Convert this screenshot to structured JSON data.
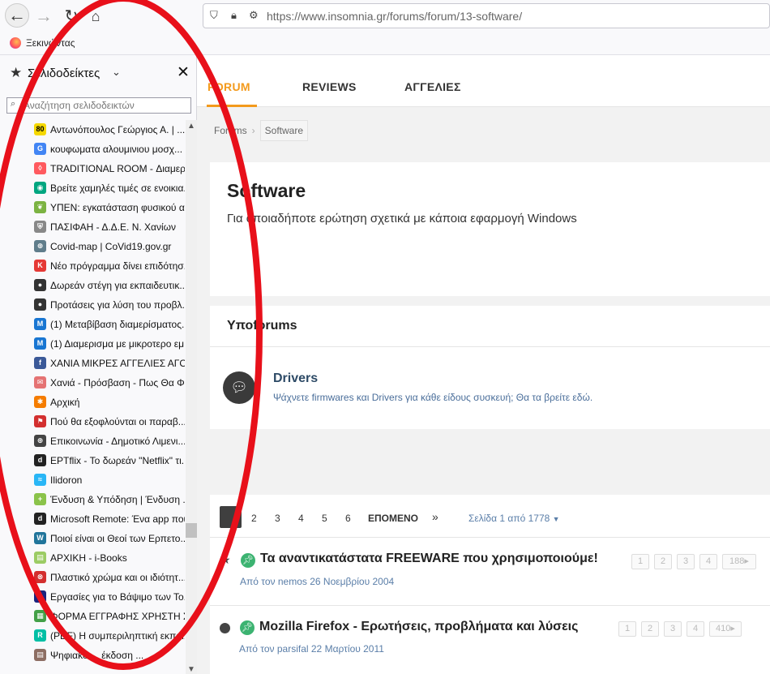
{
  "browser": {
    "url": "https://www.insomnia.gr/forums/forum/13-software/",
    "bookmarks_toolbar_label": "Ξεκινώντας"
  },
  "sidebar": {
    "title": "Σελιδοδείκτες",
    "search_placeholder": "Αναζήτηση σελιδοδεικτών",
    "items": [
      {
        "label": "Αντωνόπουλος Γεώργιος Α. | ...",
        "icon": "80",
        "color": "#f5d800"
      },
      {
        "label": "κουφωματα αλουμινιου μοσχ...",
        "icon": "G",
        "color": "#4285f4"
      },
      {
        "label": "TRADITIONAL ROOM - Διαμερί...",
        "icon": "airbnb",
        "color": "#ff5a5f"
      },
      {
        "label": "Βρείτε χαμηλές τιμές σε ενοικια...",
        "icon": "tripadvisor",
        "color": "#00a680"
      },
      {
        "label": "ΥΠΕΝ: εγκατάσταση φυσικού α...",
        "icon": "leaf",
        "color": "#7cb342"
      },
      {
        "label": "ΠΑΣΙΦΑΗ - Δ.Δ.Ε. Ν. Χανίων",
        "icon": "shield",
        "color": "#888888"
      },
      {
        "label": "Covid-map | CoVid19.gov.gr",
        "icon": "globe",
        "color": "#607d8b"
      },
      {
        "label": "Νέο πρόγραμμα δίνει επιδότησ...",
        "icon": "K",
        "color": "#e53935"
      },
      {
        "label": "Δωρεάν στέγη για εκπαιδευτικ...",
        "icon": "head",
        "color": "#333333"
      },
      {
        "label": "Προτάσεις για λύση του προβλ...",
        "icon": "head",
        "color": "#333333"
      },
      {
        "label": "(1) Μεταβίβαση διαμερίσματος...",
        "icon": "M",
        "color": "#1976d2"
      },
      {
        "label": "(1) Διαμερισμα με μικροτερο εμ...",
        "icon": "M",
        "color": "#1976d2"
      },
      {
        "label": "ΧΑΝΙΑ ΜΙΚΡΕΣ ΑΓΓΕΛΙΕΣ ΑΓΟΡ...",
        "icon": "f",
        "color": "#3b5998"
      },
      {
        "label": "Χανιά - Πρόσβαση - Πως Θα Φ...",
        "icon": "envelope",
        "color": "#e57373"
      },
      {
        "label": "Αρχική",
        "icon": "joomla",
        "color": "#f57c00"
      },
      {
        "label": "Πού θα εξοφλούνται οι παραβ...",
        "icon": "flag",
        "color": "#d32f2f"
      },
      {
        "label": "Επικοινωνία - Δημοτικό Λιμενι...",
        "icon": "globe",
        "color": "#444444"
      },
      {
        "label": "EPTflix - Το δωρεάν \"Netflix\" τι...",
        "icon": "d",
        "color": "#222222"
      },
      {
        "label": "Ilidoron",
        "icon": "wave",
        "color": "#29b6f6"
      },
      {
        "label": "Ένδυση & Υπόδηση | Ένδυση ...",
        "icon": "plus",
        "color": "#8bc34a"
      },
      {
        "label": "Microsoft Remote: Ένα app που...",
        "icon": "d",
        "color": "#222222"
      },
      {
        "label": "Ποιοί είναι οι Θεοί των Ερπετο...",
        "icon": "W",
        "color": "#21759b"
      },
      {
        "label": "ΑΡΧΙΚΗ - i-Books",
        "icon": "books",
        "color": "#9ccc65"
      },
      {
        "label": "Πλαστικό χρώμα και οι ιδιότητ...",
        "icon": "ball",
        "color": "#d32f2f"
      },
      {
        "label": "Εργασίες για το Βάψιμο των Το...",
        "icon": "plane",
        "color": "#1a237e"
      },
      {
        "label": "ΦΟΡΜΑ ΕΓΓΡΑΦΗΣ ΧΡΗΣΤΗ ΣΤ...",
        "icon": "form",
        "color": "#43a047"
      },
      {
        "label": "(PDF) Η συμπεριληπτική εκπαί...",
        "icon": "R",
        "color": "#00bfa5"
      },
      {
        "label": "Ψηφιακό ... έκδοση ...",
        "icon": "books",
        "color": "#8d6e63"
      }
    ]
  },
  "forum": {
    "nav_tabs": [
      "FORUM",
      "REVIEWS",
      "ΑΓΓΕΛΙΕΣ"
    ],
    "breadcrumb": [
      "Forums",
      "Software"
    ],
    "title": "Software",
    "description": "Για οποιαδήποτε ερώτηση σχετικά με κάποια εφαρμογή Windows",
    "subforums_heading": "Υποforums",
    "subforum": {
      "name": "Drivers",
      "description": "Ψάχνετε firmwares και Drivers για κάθε είδους συσκευή; Θα τα βρείτε εδώ."
    },
    "pagination": {
      "pages": [
        "2",
        "3",
        "4",
        "5",
        "6"
      ],
      "next_label": "ΕΠΟΜΕΝΟ",
      "last_label": "»",
      "page_info": "Σελίδα 1 από 1778"
    },
    "threads": [
      {
        "title": "Τα αναντικατάστατα FREEWARE που χρησιμοποιούμε!",
        "meta": "Από τον nemos 26 Νοεμβρίου 2004",
        "pages": [
          "1",
          "2",
          "3",
          "4",
          "188"
        ]
      },
      {
        "title": "Mozilla Firefox - Ερωτήσεις, προβλήματα και λύσεις",
        "meta": "Από τον parsifal 22 Μαρτίου 2011",
        "pages": [
          "1",
          "2",
          "3",
          "4",
          "410"
        ]
      }
    ]
  }
}
